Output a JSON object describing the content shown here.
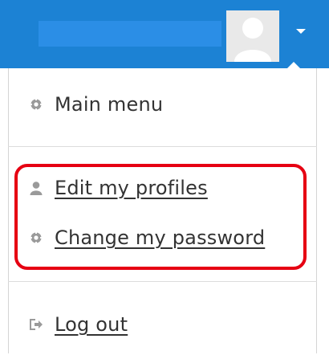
{
  "header": {
    "user_menu_toggle_icon": "caret-down-icon",
    "avatar_icon": "user-avatar-icon"
  },
  "menu": {
    "items": [
      {
        "label": "Main menu",
        "icon": "gear-icon",
        "style": "plain"
      },
      {
        "label": "Edit my profiles",
        "icon": "user-icon",
        "style": "link"
      },
      {
        "label": "Change my password",
        "icon": "gear-icon",
        "style": "link"
      },
      {
        "label": "Log out",
        "icon": "sign-out-icon",
        "style": "link"
      }
    ]
  },
  "colors": {
    "topbar": "#1c82d4",
    "highlight": "#e60012",
    "text": "#333333",
    "icon": "#999999"
  }
}
